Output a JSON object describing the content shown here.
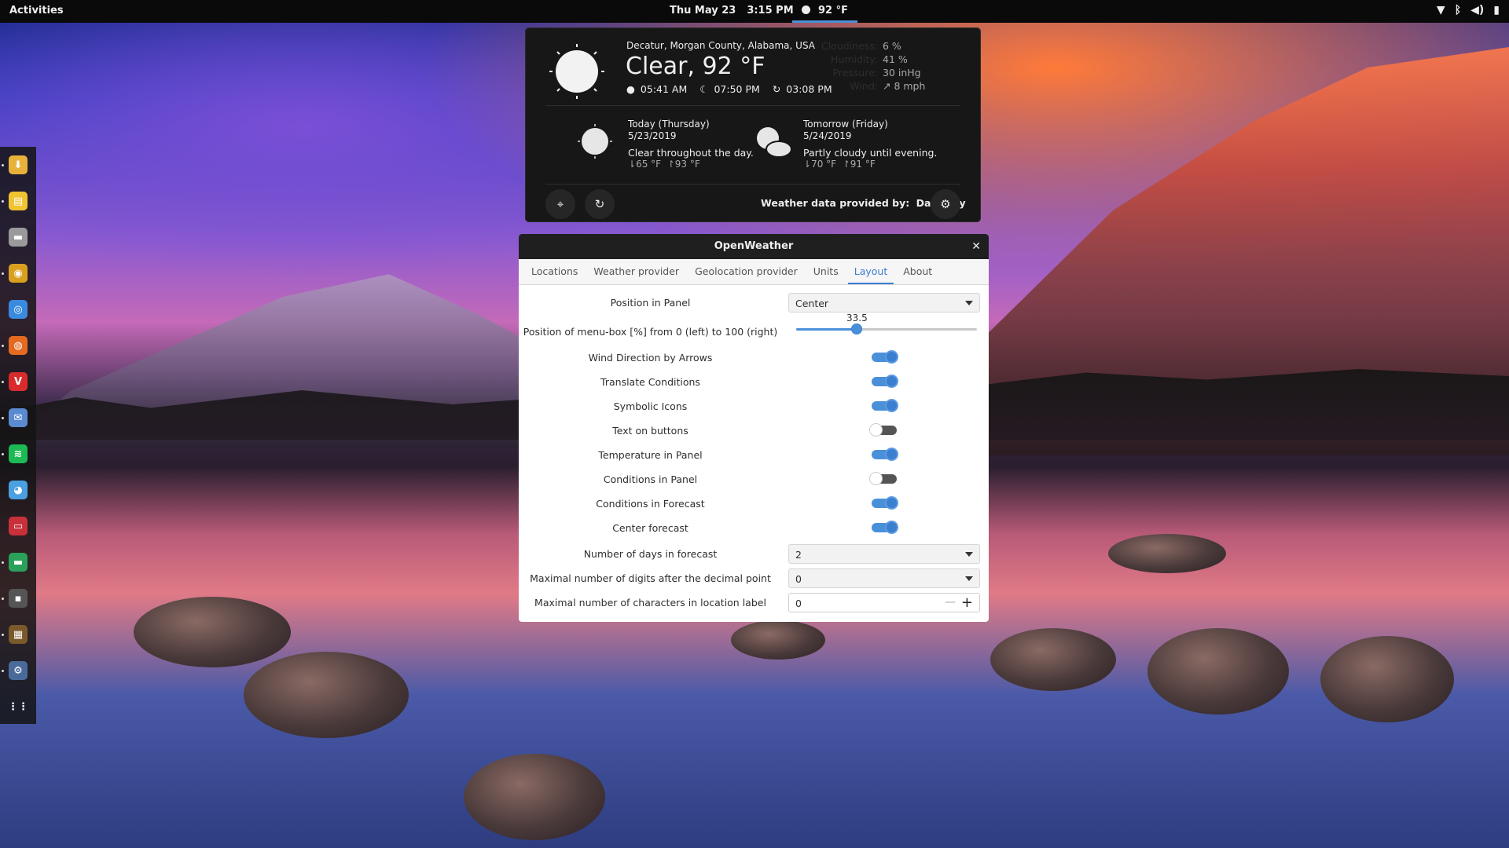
{
  "topbar": {
    "activities": "Activities",
    "date": "Thu May 23",
    "time": "3:15 PM",
    "panel_temp": "92 °F"
  },
  "dock": {
    "items": [
      {
        "icon": "download-icon",
        "color": "#e8b23a"
      },
      {
        "icon": "notes-icon",
        "color": "#f0c330"
      },
      {
        "icon": "files-icon",
        "color": "#9a9a9a"
      },
      {
        "icon": "speaker-icon",
        "color": "#d9a020"
      },
      {
        "icon": "chrome-icon",
        "color": "#3a8ae0"
      },
      {
        "icon": "firefox-icon",
        "color": "#e56a20"
      },
      {
        "icon": "vivaldi-icon",
        "color": "#d92b2b"
      },
      {
        "icon": "mail-icon",
        "color": "#5a8ad0"
      },
      {
        "icon": "spotify-icon",
        "color": "#1db954"
      },
      {
        "icon": "bird-icon",
        "color": "#4aa0e0"
      },
      {
        "icon": "cassette-icon",
        "color": "#c8303a"
      },
      {
        "icon": "monitor-icon",
        "color": "#2aa05a"
      },
      {
        "icon": "terminal-icon",
        "color": "#555555"
      },
      {
        "icon": "minecraft-icon",
        "color": "#7a5a2a"
      },
      {
        "icon": "settings-icon",
        "color": "#4a6a9a"
      },
      {
        "icon": "app-grid-icon",
        "color": "transparent"
      }
    ]
  },
  "weather": {
    "location": "Decatur, Morgan County, Alabama, USA",
    "condition": "Clear, 92 °F",
    "sunrise": "05:41 AM",
    "sunset": "07:50 PM",
    "updated": "03:08 PM",
    "details": [
      {
        "label": "Cloudiness:",
        "value": "6 %"
      },
      {
        "label": "Humidity:",
        "value": "41 %"
      },
      {
        "label": "Pressure:",
        "value": "30 inHg"
      },
      {
        "label": "Wind:",
        "value": "↗ 8 mph"
      }
    ],
    "forecast": [
      {
        "day": "Today (Thursday)",
        "date": "5/23/2019",
        "desc": "Clear throughout the day.",
        "low": "65 °F",
        "high": "93 °F"
      },
      {
        "day": "Tomorrow (Friday)",
        "date": "5/24/2019",
        "desc": "Partly cloudy until evening.",
        "low": "70 °F",
        "high": "91 °F"
      }
    ],
    "credit_label": "Weather data provided by:",
    "credit_provider": "Dark Sky"
  },
  "dialog": {
    "title": "OpenWeather",
    "tabs": [
      "Locations",
      "Weather provider",
      "Geolocation provider",
      "Units",
      "Layout",
      "About"
    ],
    "active_tab": "Layout",
    "position_label": "Position in Panel",
    "position_value": "Center",
    "menubox_label": "Position of menu-box [%] from 0 (left) to 100 (right)",
    "menubox_value": "33.5",
    "menubox_fraction": 0.335,
    "toggles": [
      {
        "label": "Wind Direction by Arrows",
        "on": true
      },
      {
        "label": "Translate Conditions",
        "on": true
      },
      {
        "label": "Symbolic Icons",
        "on": true
      },
      {
        "label": "Text on buttons",
        "on": false
      },
      {
        "label": "Temperature in Panel",
        "on": true
      },
      {
        "label": "Conditions in Panel",
        "on": false
      },
      {
        "label": "Conditions in Forecast",
        "on": true
      },
      {
        "label": "Center forecast",
        "on": true
      }
    ],
    "days_label": "Number of days in forecast",
    "days_value": "2",
    "decimals_label": "Maximal number of digits after the decimal point",
    "decimals_value": "0",
    "chars_label": "Maximal number of characters in location label",
    "chars_value": "0"
  }
}
